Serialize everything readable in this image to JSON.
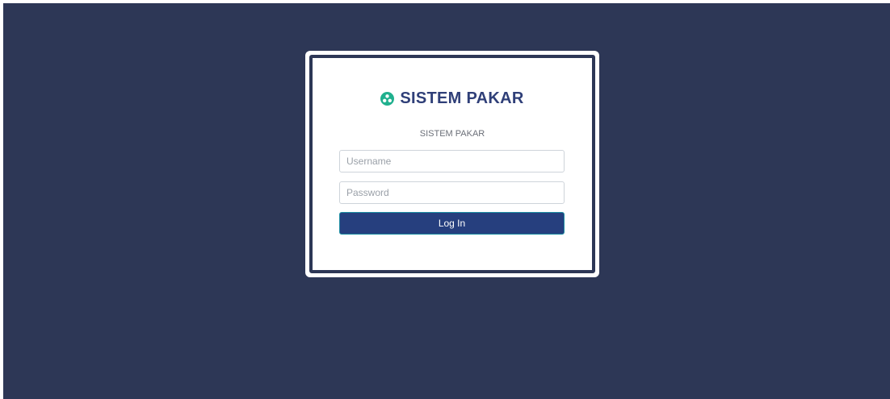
{
  "brand": {
    "title": "SISTEM PAKAR",
    "icon": "logo-circle-icon",
    "icon_color": "#20b08e"
  },
  "subtitle": "SISTEM PAKAR",
  "form": {
    "username_placeholder": "Username",
    "username_value": "",
    "password_placeholder": "Password",
    "password_value": "",
    "login_label": "Log In"
  },
  "colors": {
    "background": "#2d3756",
    "card": "#ffffff",
    "brand_text": "#2f3f78",
    "button": "#263f7e"
  }
}
